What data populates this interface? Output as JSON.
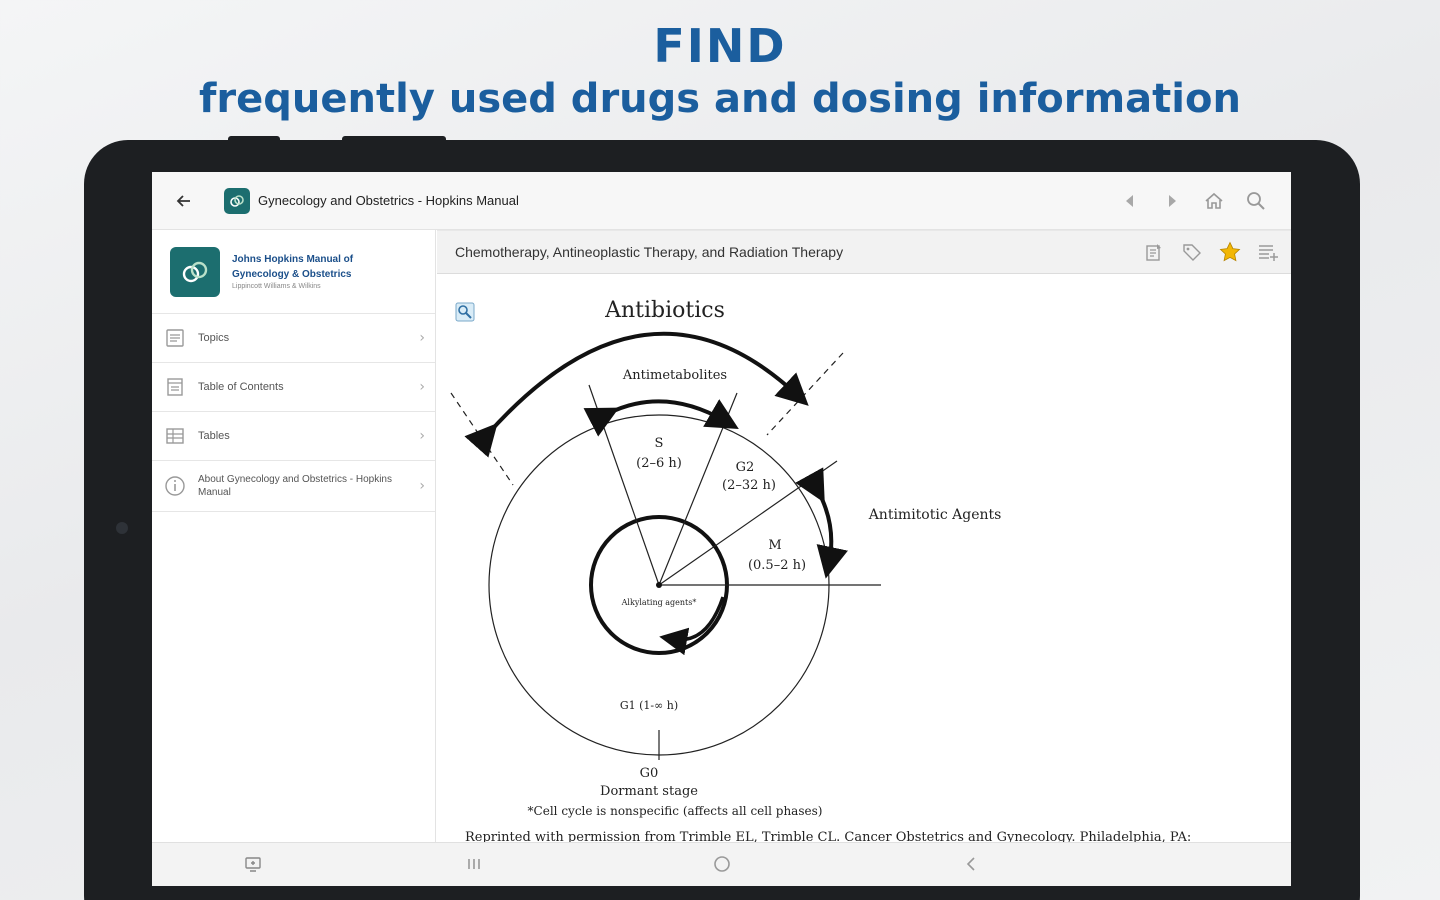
{
  "promo": {
    "title": "FIND",
    "subtitle": "frequently used drugs and dosing information"
  },
  "appbar": {
    "title": "Gynecology and Obstetrics - Hopkins Manual",
    "icons": [
      "back-arrow-icon",
      "prev-icon",
      "next-icon",
      "home-icon",
      "search-icon"
    ]
  },
  "sidebar": {
    "brand_line1": "Johns Hopkins Manual of",
    "brand_line2": "Gynecology & Obstetrics",
    "brand_line3": "Lippincott Williams & Wilkins",
    "items": [
      {
        "label": "Topics",
        "icon": "topics-icon"
      },
      {
        "label": "Table of Contents",
        "icon": "toc-icon"
      },
      {
        "label": "Tables",
        "icon": "table-icon"
      },
      {
        "label": "About Gynecology and Obstetrics - Hopkins Manual",
        "icon": "info-icon"
      }
    ]
  },
  "content": {
    "section_title": "Chemotherapy, Antineoplastic Therapy, and Radiation Therapy",
    "toolbar_icons": [
      "notes-icon",
      "tag-icon",
      "star-icon",
      "add-list-icon"
    ],
    "star_color": "#f2b705"
  },
  "diagram": {
    "title": "Antibiotics",
    "antimetabolites": "Antimetabolites",
    "s_phase": "S",
    "s_duration": "(2–6 h)",
    "g2_phase": "G2",
    "g2_duration": "(2–32 h)",
    "m_phase": "M",
    "m_duration": "(0.5–2 h)",
    "antimitotic": "Antimitotic Agents",
    "alkylating": "Alkylating agents*",
    "g1_label": "G1 (1-∞ h)",
    "g0_label": "G0",
    "dormant": "Dormant stage",
    "footnote": "*Cell cycle is nonspecific (affects all cell phases)",
    "reprint": "Reprinted with permission from Trimble EL, Trimble CL. Cancer Obstetrics and Gynecology. Philadelphia, PA:"
  },
  "system_nav": {
    "icons": [
      "screenshot-icon",
      "recents-icon",
      "home-circle-icon",
      "back-chevron-icon"
    ]
  }
}
